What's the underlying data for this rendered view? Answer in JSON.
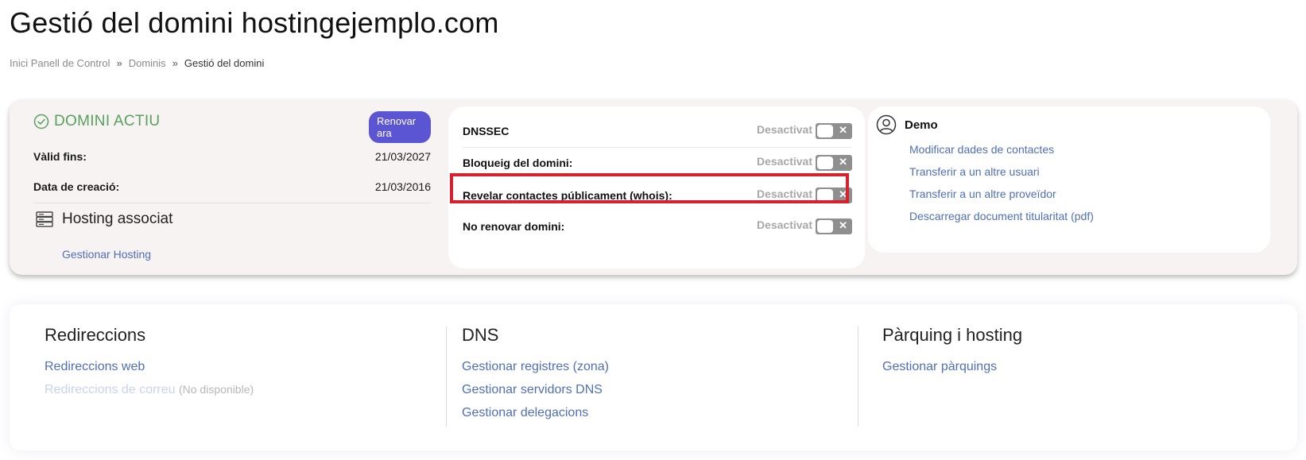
{
  "page": {
    "title": "Gestió del domini hostingejemplo.com"
  },
  "breadcrumb": {
    "home": "Inici Panell de Control",
    "separator": "»",
    "domains": "Dominis",
    "current": "Gestió del domini"
  },
  "status": {
    "label": "DOMINI ACTIU",
    "renew_button": "Renovar ara",
    "valid_until_label": "Vàlid fins:",
    "valid_until_value": "21/03/2027",
    "created_label": "Data de creació:",
    "created_value": "21/03/2016",
    "hosting_title": "Hosting associat",
    "hosting_link": "Gestionar Hosting",
    "active_color": "#58a05e"
  },
  "settings": [
    {
      "label": "DNSSEC",
      "state": "Desactivat",
      "enabled": false
    },
    {
      "label": "Bloqueig del domini:",
      "state": "Desactivat",
      "enabled": false
    },
    {
      "label": "Revelar contactes públicament (whois):",
      "state": "Desactivat",
      "enabled": false,
      "highlighted": true
    },
    {
      "label": "No renovar domini:",
      "state": "Desactivat",
      "enabled": false
    }
  ],
  "toggle_off_glyph": "✕",
  "contact": {
    "name": "Demo",
    "icon": "user-circle-icon",
    "links": [
      "Modificar dades de contactes",
      "Transferir a un altre usuari",
      "Transferir a un altre proveïdor",
      "Descarregar document titularitat (pdf)"
    ]
  },
  "sections": {
    "redirects": {
      "title": "Redireccions",
      "web": "Redireccions web",
      "mail": "Redireccions de correu",
      "mail_note": "(No disponible)"
    },
    "dns": {
      "title": "DNS",
      "links": [
        "Gestionar registres (zona)",
        "Gestionar servidors DNS",
        "Gestionar delegacions"
      ]
    },
    "parking": {
      "title": "Pàrquing i hosting",
      "links": [
        "Gestionar pàrquings"
      ]
    }
  },
  "colors": {
    "link": "#4f6fb8",
    "renew_button": "#5b55d4",
    "highlight": "#d9202c"
  }
}
